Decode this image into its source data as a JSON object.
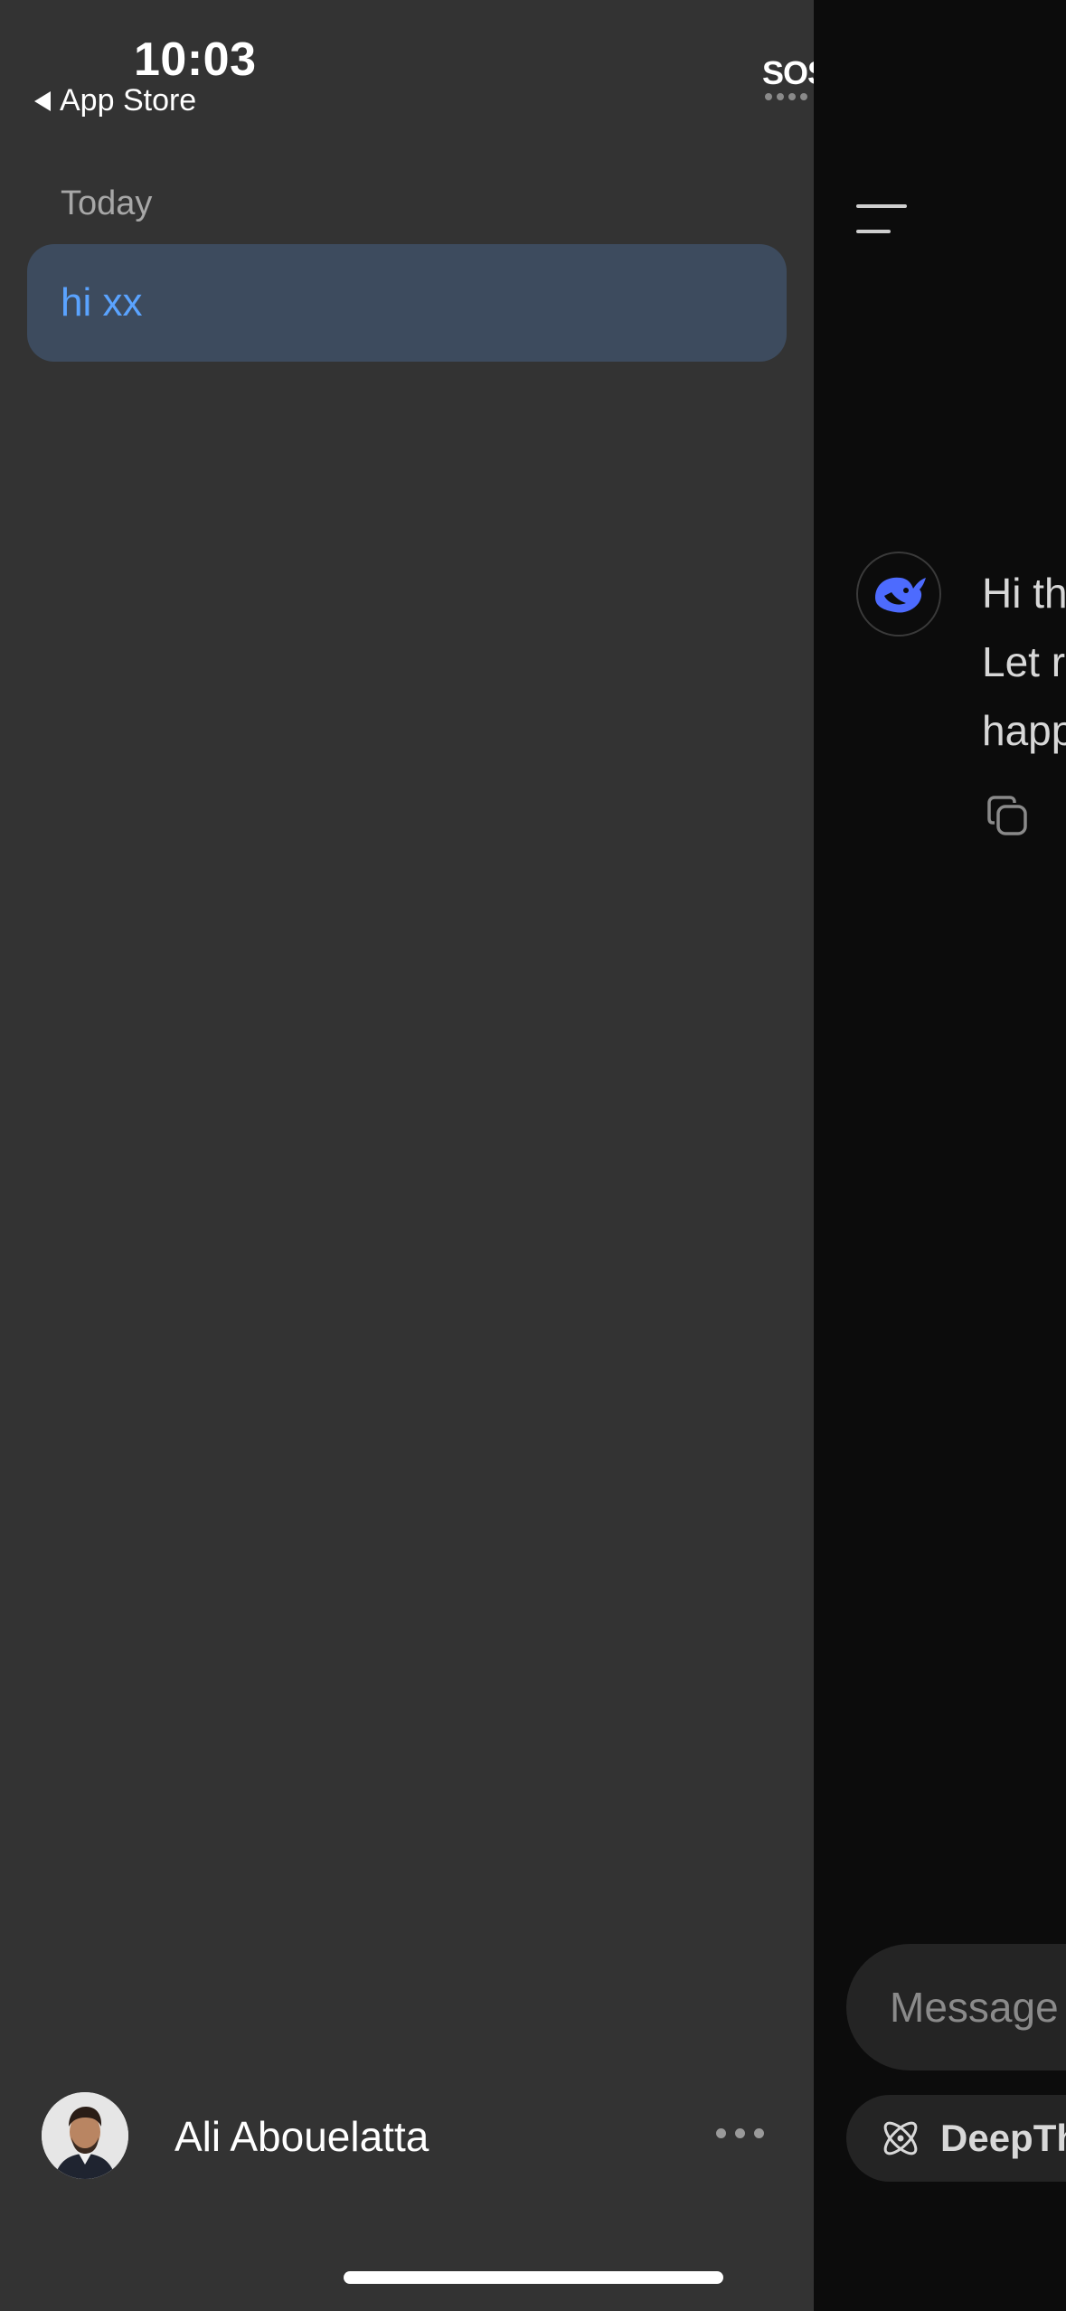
{
  "status_bar": {
    "time": "10:03",
    "back_label": "App Store",
    "sos": "SOS"
  },
  "sidebar": {
    "section_label": "Today",
    "chats": [
      {
        "label": "hi xx",
        "selected": true
      }
    ],
    "profile": {
      "name": "Ali Abouelatta"
    }
  },
  "conversation": {
    "assistant_message_lines": [
      "Hi th",
      "Let r",
      "happ"
    ]
  },
  "composer": {
    "placeholder": "Message",
    "deepthink_label": "DeepTh"
  },
  "colors": {
    "accent": "#5aa3ff",
    "brand_whale": "#4d6bfe",
    "drawer_bg": "#333333",
    "selected_bg": "#3d4b5e",
    "main_bg": "#0c0c0c"
  }
}
